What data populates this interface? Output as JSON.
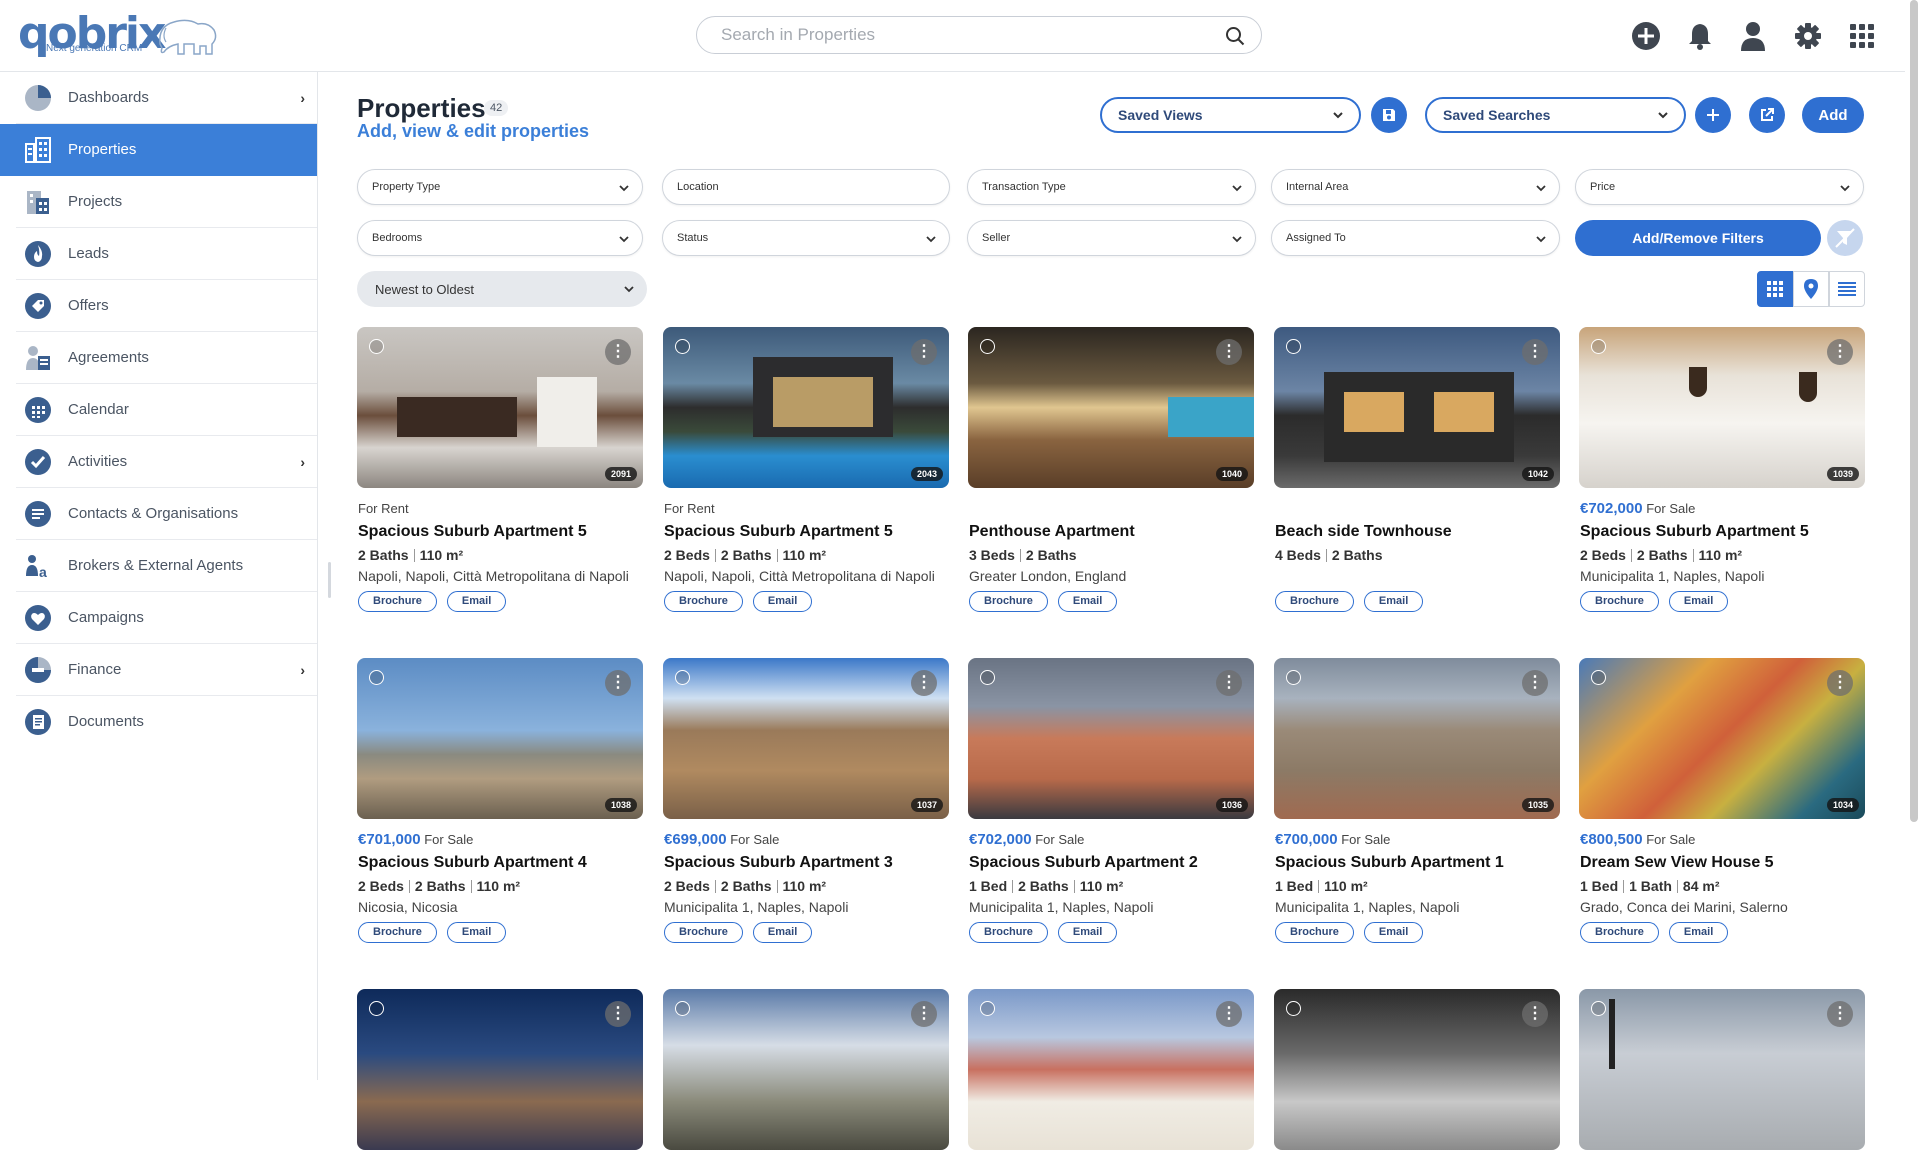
{
  "header": {
    "logo_text": "qobrix",
    "logo_tagline": "Next generation CRM",
    "search_placeholder": "Search in Properties",
    "icons": [
      "plus-circle-icon",
      "bell-icon",
      "user-icon",
      "gear-icon",
      "apps-grid-icon"
    ]
  },
  "sidebar": {
    "items": [
      {
        "label": "Dashboards",
        "icon": "pie-chart-icon",
        "chevron": true
      },
      {
        "label": "Properties",
        "icon": "building-icon",
        "active": true
      },
      {
        "label": "Projects",
        "icon": "project-building-icon"
      },
      {
        "label": "Leads",
        "icon": "flame-icon"
      },
      {
        "label": "Offers",
        "icon": "tag-icon"
      },
      {
        "label": "Agreements",
        "icon": "agreement-icon"
      },
      {
        "label": "Calendar",
        "icon": "calendar-icon"
      },
      {
        "label": "Activities",
        "icon": "check-circle-icon",
        "chevron": true
      },
      {
        "label": "Contacts & Organisations",
        "icon": "contacts-icon"
      },
      {
        "label": "Brokers & External Agents",
        "icon": "brokers-icon"
      },
      {
        "label": "Campaigns",
        "icon": "heart-icon"
      },
      {
        "label": "Finance",
        "icon": "finance-icon",
        "chevron": true
      },
      {
        "label": "Documents",
        "icon": "documents-icon"
      }
    ]
  },
  "page": {
    "title": "Properties",
    "count": "42",
    "subtitle": "Add, view & edit properties",
    "saved_views": "Saved Views",
    "saved_searches": "Saved Searches",
    "add": "Add"
  },
  "filters": {
    "row1": [
      "Property Type",
      "Location",
      "Transaction Type",
      "Internal Area",
      "Price"
    ],
    "row2": [
      "Bedrooms",
      "Status",
      "Seller",
      "Assigned To"
    ],
    "add_remove": "Add/Remove Filters",
    "sort": "Newest to Oldest"
  },
  "colors": {
    "accent": "#2f6fd1",
    "active_nav": "#3b7fd8"
  },
  "buttons": {
    "brochure": "Brochure",
    "email": "Email"
  },
  "cards": [
    {
      "price": "",
      "type": "For Rent",
      "name": "Spacious Suburb Apartment 5",
      "specs": [
        "2 Baths",
        "110 m²"
      ],
      "location": "Napoli, Napoli, Città Metropolitana di Napoli",
      "ref": "2091"
    },
    {
      "price": "",
      "type": "For Rent",
      "name": "Spacious Suburb Apartment 5",
      "specs": [
        "2 Beds",
        "2 Baths",
        "110 m²"
      ],
      "location": "Napoli, Napoli, Città Metropolitana di Napoli",
      "ref": "2043"
    },
    {
      "price": "",
      "type": "",
      "name": "Penthouse Apartment",
      "specs": [
        "3 Beds",
        "2 Baths"
      ],
      "location": "Greater London, England",
      "ref": "1040"
    },
    {
      "price": "",
      "type": "",
      "name": "Beach side Townhouse",
      "specs": [
        "4 Beds",
        "2 Baths"
      ],
      "location": "",
      "ref": "1042"
    },
    {
      "price": "€702,000",
      "type": "For Sale",
      "name": "Spacious Suburb Apartment 5",
      "specs": [
        "2 Beds",
        "2 Baths",
        "110 m²"
      ],
      "location": "Municipalita 1, Naples, Napoli",
      "ref": "1039"
    },
    {
      "price": "€701,000",
      "type": "For Sale",
      "name": "Spacious Suburb Apartment 4",
      "specs": [
        "2 Beds",
        "2 Baths",
        "110 m²"
      ],
      "location": "Nicosia, Nicosia",
      "ref": "1038"
    },
    {
      "price": "€699,000",
      "type": "For Sale",
      "name": "Spacious Suburb Apartment 3",
      "specs": [
        "2 Beds",
        "2 Baths",
        "110 m²"
      ],
      "location": "Municipalita 1, Naples, Napoli",
      "ref": "1037"
    },
    {
      "price": "€702,000",
      "type": "For Sale",
      "name": "Spacious Suburb Apartment 2",
      "specs": [
        "1 Bed",
        "2 Baths",
        "110 m²"
      ],
      "location": "Municipalita 1, Naples, Napoli",
      "ref": "1036"
    },
    {
      "price": "€700,000",
      "type": "For Sale",
      "name": "Spacious Suburb Apartment 1",
      "specs": [
        "1 Bed",
        "110 m²"
      ],
      "location": "Municipalita 1, Naples, Napoli",
      "ref": "1035"
    },
    {
      "price": "€800,500",
      "type": "For Sale",
      "name": "Dream Sew View House 5",
      "specs": [
        "1 Bed",
        "1 Bath",
        "84 m²"
      ],
      "location": "Grado, Conca dei Marini, Salerno",
      "ref": "1034"
    }
  ]
}
